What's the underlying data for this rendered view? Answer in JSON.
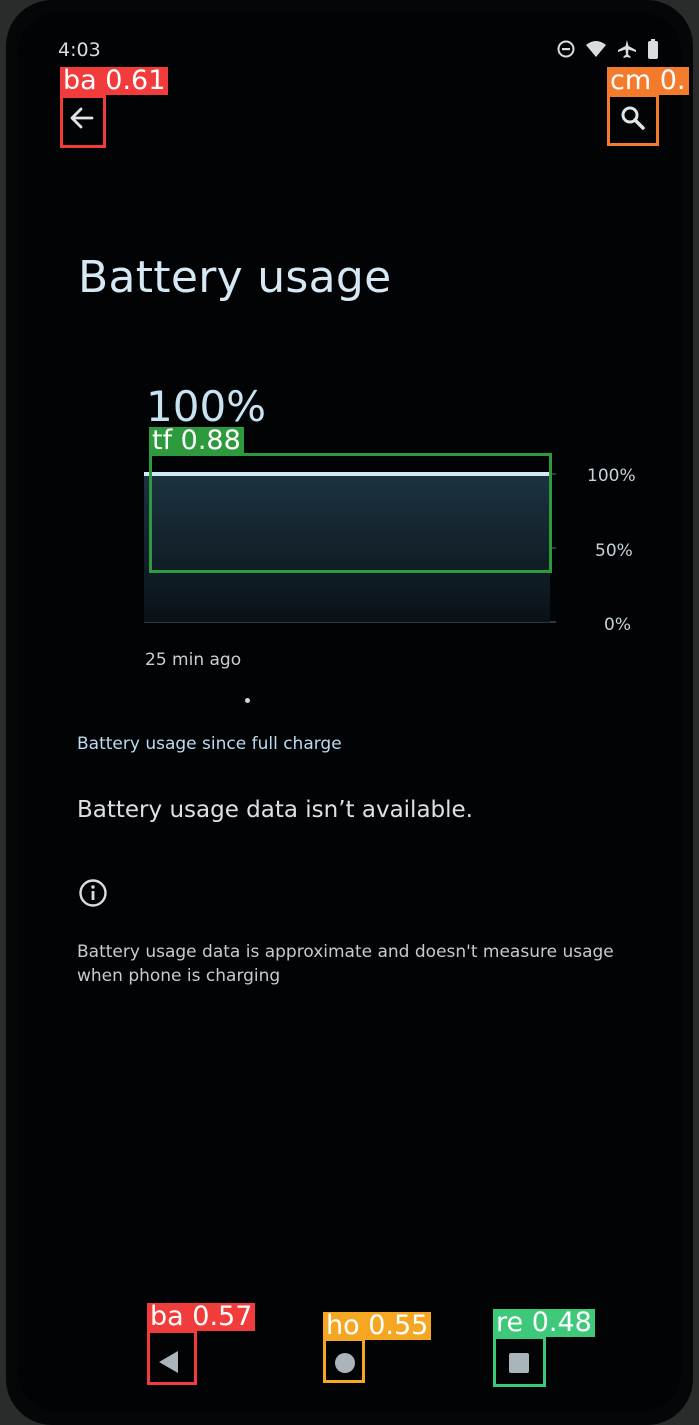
{
  "status_bar": {
    "time": "4:03",
    "icons": [
      "do-not-disturb-icon",
      "wifi-icon",
      "airplane-icon",
      "battery-icon"
    ]
  },
  "toolbar": {
    "back_icon": "arrow-left-icon",
    "search_icon": "search-icon"
  },
  "page": {
    "title": "Battery usage",
    "battery_percent": "100%",
    "chart_axis": {
      "top": "100%",
      "middle": "50%",
      "bottom": "0%"
    },
    "chart_time_label": "25 min ago",
    "section_label": "Battery usage since full charge",
    "no_data_message": "Battery usage data isn’t available.",
    "footnote": "Battery usage data is approximate and doesn't measure usage when phone is charging"
  },
  "nav_bar": {
    "back_icon": "triangle-back-icon",
    "home_icon": "circle-home-icon",
    "recents_icon": "square-recents-icon"
  },
  "detections": [
    {
      "label": "ba 0.61",
      "color": "#f23c3c"
    },
    {
      "label": "cm 0.",
      "color": "#f47a2c"
    },
    {
      "label": "tf 0.88",
      "color": "#2e9a3e"
    },
    {
      "label": "ba 0.57",
      "color": "#f23c3c"
    },
    {
      "label": "ho 0.55",
      "color": "#f5a623"
    },
    {
      "label": "re 0.48",
      "color": "#3ec97a"
    }
  ],
  "chart_data": {
    "type": "area",
    "title": "",
    "xlabel": "",
    "ylabel": "",
    "x_tick_labels": [
      "25 min ago"
    ],
    "y_tick_labels": [
      "100%",
      "50%",
      "0%"
    ],
    "ylim": [
      0,
      100
    ],
    "series": [
      {
        "values": [
          100,
          100
        ]
      }
    ],
    "grid": true
  }
}
